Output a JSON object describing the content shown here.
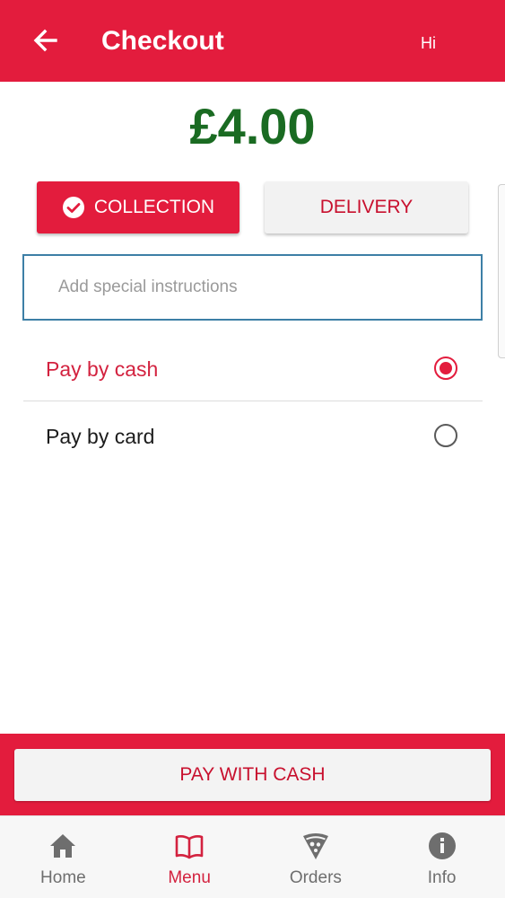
{
  "header": {
    "title": "Checkout",
    "greeting": "Hi"
  },
  "order": {
    "total": "£4.00"
  },
  "fulfilment": {
    "options": [
      {
        "label": "COLLECTION",
        "selected": true
      },
      {
        "label": "DELIVERY",
        "selected": false
      }
    ]
  },
  "instructions": {
    "value": "",
    "placeholder": "Add special instructions"
  },
  "payment": {
    "options": [
      {
        "label": "Pay by cash",
        "selected": true
      },
      {
        "label": "Pay by card",
        "selected": false
      }
    ]
  },
  "actions": {
    "pay_label": "PAY WITH CASH"
  },
  "nav": {
    "items": [
      {
        "label": "Home",
        "icon": "home-icon",
        "active": false
      },
      {
        "label": "Menu",
        "icon": "book-icon",
        "active": true
      },
      {
        "label": "Orders",
        "icon": "pizza-slice-icon",
        "active": false
      },
      {
        "label": "Info",
        "icon": "info-icon",
        "active": false
      }
    ]
  },
  "colors": {
    "brand": "#e31c3d",
    "price": "#1a6b22",
    "input_border": "#3d7fa6",
    "nav_bg": "#f7f7f7"
  }
}
